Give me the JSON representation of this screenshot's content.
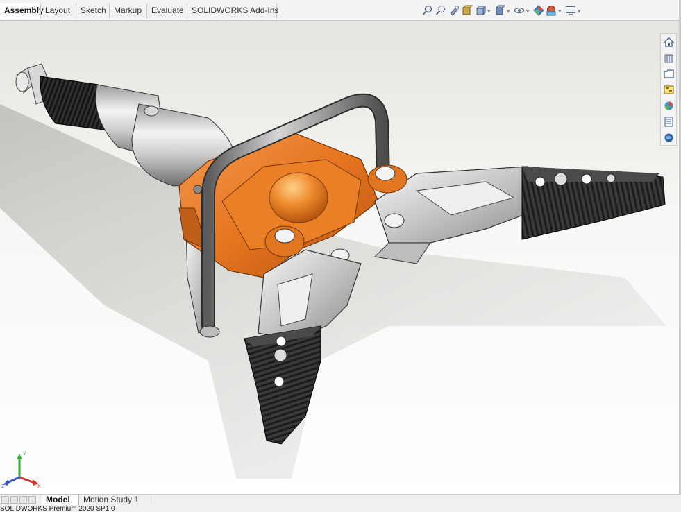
{
  "command_manager": {
    "tabs": [
      {
        "label": "Assembly",
        "active": true
      },
      {
        "label": "Layout",
        "active": false
      },
      {
        "label": "Sketch",
        "active": false
      },
      {
        "label": "Markup",
        "active": false
      },
      {
        "label": "Evaluate",
        "active": false
      },
      {
        "label": "SOLIDWORKS Add-Ins",
        "active": false
      }
    ]
  },
  "heads_up_toolbar": {
    "icons": [
      "zoom-to-fit-icon",
      "zoom-to-area-icon",
      "previous-view-icon",
      "section-view-icon",
      "view-orientation-icon",
      "display-style-icon",
      "hide-show-items-icon",
      "edit-appearance-icon",
      "apply-scene-icon",
      "view-settings-icon"
    ]
  },
  "task_pane": {
    "icons": [
      "home-icon",
      "design-library-icon",
      "file-explorer-icon",
      "view-palette-icon",
      "appearances-icon",
      "custom-properties-icon",
      "solidworks-forum-icon"
    ]
  },
  "bottom_tabs": [
    {
      "label": "Model",
      "active": true
    },
    {
      "label": "Motion Study 1",
      "active": false
    }
  ],
  "status_bar": {
    "text": "SOLIDWORKS Premium 2020 SP1.0"
  },
  "triad": {
    "x_label": "X",
    "y_label": "Y",
    "z_label": "Z"
  },
  "colors": {
    "orange_body": "#e8782a",
    "dark_jaw": "#2b2b2b",
    "triad_x": "#d0342c",
    "triad_y": "#3cab3c",
    "triad_z": "#2f56c6"
  }
}
